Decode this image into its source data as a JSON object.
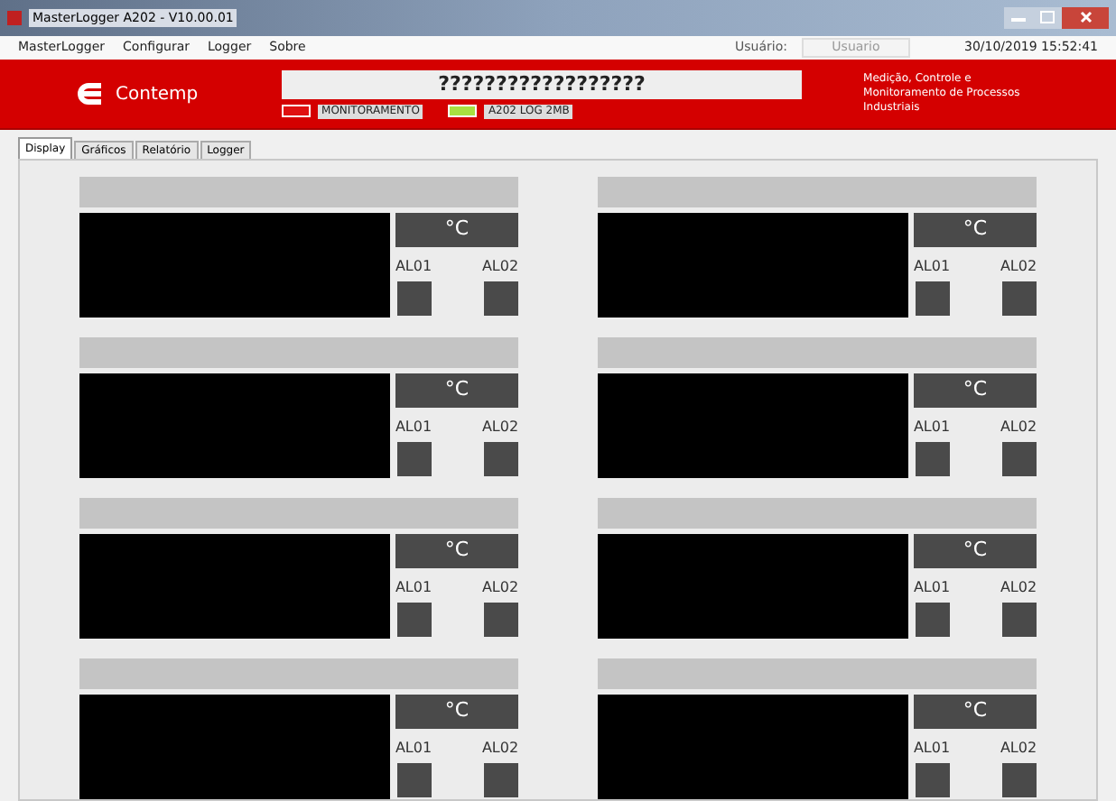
{
  "window": {
    "title": "MasterLogger A202 - V10.00.01"
  },
  "menu": [
    "MasterLogger",
    "Configurar",
    "Logger",
    "Sobre"
  ],
  "user": {
    "label": "Usuário:",
    "value": "Usuario"
  },
  "clock": "30/10/2019 15:52:41",
  "header": {
    "brand": "Contemp",
    "title": "??????????????????",
    "slogan": "Medição, Controle e Monitoramento de Processos Industriais",
    "indicators": [
      {
        "label": "MONITORAMENTO",
        "color": "#e01010"
      },
      {
        "label": "A202 LOG 2MB",
        "color": "#a8e040"
      }
    ]
  },
  "tabs": [
    {
      "label": "Display",
      "selected": true
    },
    {
      "label": "Gráficos",
      "selected": false
    },
    {
      "label": "Relatório",
      "selected": false
    },
    {
      "label": "Logger",
      "selected": false
    }
  ],
  "channels": [
    {
      "unit": "°C",
      "alarms": [
        "AL01",
        "AL02"
      ]
    },
    {
      "unit": "°C",
      "alarms": [
        "AL01",
        "AL02"
      ]
    },
    {
      "unit": "°C",
      "alarms": [
        "AL01",
        "AL02"
      ]
    },
    {
      "unit": "°C",
      "alarms": [
        "AL01",
        "AL02"
      ]
    },
    {
      "unit": "°C",
      "alarms": [
        "AL01",
        "AL02"
      ]
    },
    {
      "unit": "°C",
      "alarms": [
        "AL01",
        "AL02"
      ]
    },
    {
      "unit": "°C",
      "alarms": [
        "AL01",
        "AL02"
      ]
    },
    {
      "unit": "°C",
      "alarms": [
        "AL01",
        "AL02"
      ]
    }
  ]
}
